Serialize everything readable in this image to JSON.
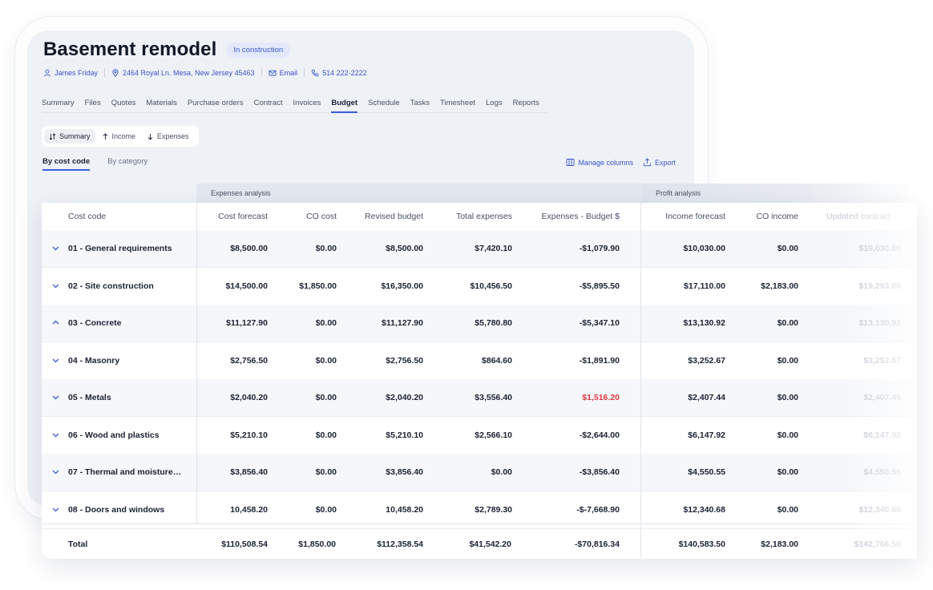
{
  "project": {
    "title": "Basement remodel",
    "status": "In construction",
    "owner": "James Friday",
    "address": "2464 Royal Ln. Mesa, New Jersey 45463",
    "email_label": "Email",
    "phone": "514 222-2222"
  },
  "nav_tabs": [
    "Summary",
    "Files",
    "Quotes",
    "Materials",
    "Purchase orders",
    "Contract",
    "Invoices",
    "Budget",
    "Schedule",
    "Tasks",
    "Timesheet",
    "Logs",
    "Reports"
  ],
  "nav_active": "Budget",
  "segments": [
    {
      "label": "Summary",
      "icon": "sort-icon",
      "active": true
    },
    {
      "label": "Income",
      "icon": "arrow-up-icon",
      "active": false
    },
    {
      "label": "Expenses",
      "icon": "arrow-down-icon",
      "active": false
    }
  ],
  "sub_tabs": {
    "by_cost_code": "By cost code",
    "by_category": "By category"
  },
  "actions": {
    "manage_columns": "Manage columns",
    "export": "Export"
  },
  "groups": {
    "expenses": "Expenses analysis",
    "profit": "Profit analysis"
  },
  "columns": [
    "Cost code",
    "Cost forecast",
    "CO cost",
    "Revised budget",
    "Total expenses",
    "Expenses - Budget $",
    "Income forecast",
    "CO income",
    "Updated contract"
  ],
  "rows": [
    {
      "name": "01 - General requirements",
      "expanded": false,
      "values": [
        "$8,500.00",
        "$0.00",
        "$8,500.00",
        "$7,420.10",
        "-$1,079.90",
        "$10,030.00",
        "$0.00",
        "$10,030.00"
      ],
      "negative": false
    },
    {
      "name": "02 - Site construction",
      "expanded": false,
      "values": [
        "$14,500.00",
        "$1,850.00",
        "$16,350.00",
        "$10,456.50",
        "-$5,895.50",
        "$17,110.00",
        "$2,183.00",
        "$19,293.00"
      ],
      "negative": false
    },
    {
      "name": "03 - Concrete",
      "expanded": true,
      "values": [
        "$11,127.90",
        "$0.00",
        "$11,127.90",
        "$5,780.80",
        "-$5,347.10",
        "$13,130.92",
        "$0.00",
        "$13,130.92"
      ],
      "negative": false
    },
    {
      "name": "04 - Masonry",
      "expanded": false,
      "values": [
        "$2,756.50",
        "$0.00",
        "$2,756.50",
        "$864.60",
        "-$1,891.90",
        "$3,252.67",
        "$0.00",
        "$3,252.67"
      ],
      "negative": false
    },
    {
      "name": "05 - Metals",
      "expanded": false,
      "values": [
        "$2,040.20",
        "$0.00",
        "$2,040.20",
        "$3,556.40",
        "$1,516.20",
        "$2,407.44",
        "$0.00",
        "$2,407.44"
      ],
      "negative": true
    },
    {
      "name": "06 - Wood and plastics",
      "expanded": false,
      "values": [
        "$5,210.10",
        "$0.00",
        "$5,210.10",
        "$2,566.10",
        "-$2,644.00",
        "$6,147.92",
        "$0.00",
        "$6,147.92"
      ],
      "negative": false
    },
    {
      "name": "07 - Thermal and moisture…",
      "expanded": false,
      "values": [
        "$3,856.40",
        "$0.00",
        "$3,856.40",
        "$0.00",
        "-$3,856.40",
        "$4,550.55",
        "$0.00",
        "$4,550.55"
      ],
      "negative": false
    },
    {
      "name": "08 - Doors and windows",
      "expanded": false,
      "values": [
        "10,458.20",
        "$0.00",
        "10,458.20",
        "$2,789.30",
        "-$-7,668.90",
        "$12,340.68",
        "$0.00",
        "$12,340.68"
      ],
      "negative": false
    }
  ],
  "total": {
    "label": "Total",
    "values": [
      "$110,508.54",
      "$1,850.00",
      "$112,358.54",
      "$41,542.20",
      "-$70,816.34",
      "$140,583.50",
      "$2,183.00",
      "$142,766.50"
    ]
  },
  "colors": {
    "accent": "#3d5bd9",
    "negative": "#e0393e"
  }
}
